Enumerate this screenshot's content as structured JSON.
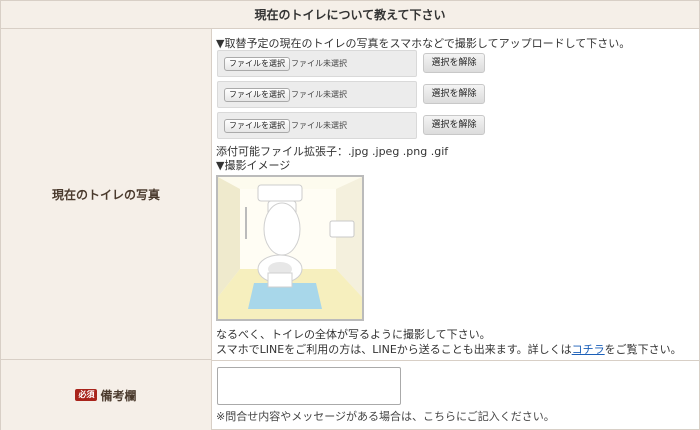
{
  "header": {
    "title": "現在のトイレについて教えて下さい"
  },
  "photo_row": {
    "label": "現在のトイレの写真",
    "instruction": "▼取替予定の現在のトイレの写真をスマホなどで撮影してアップロードして下さい。",
    "file_inputs": [
      {
        "button": "ファイルを選択",
        "status": "ファイル未選択",
        "clear_label": "選択を解除"
      },
      {
        "button": "ファイルを選択",
        "status": "ファイル未選択",
        "clear_label": "選択を解除"
      },
      {
        "button": "ファイルを選択",
        "status": "ファイル未選択",
        "clear_label": "選択を解除"
      }
    ],
    "allowed_ext": "添付可能ファイル拡張子：.jpg .jpeg .png .gif",
    "example_heading": "▼撮影イメージ",
    "note1": "なるべく、トイレの全体が写るように撮影して下さい。",
    "note2_prefix": "スマホでLINEをご利用の方は、LINEから送ることも出来ます。詳しくは",
    "note2_link": "コチラ",
    "note2_suffix": "をご覧下さい。"
  },
  "remarks_row": {
    "badge": "必須",
    "label": "備考欄",
    "textarea_value": "",
    "hint": "※問合せ内容やメッセージがある場合は、こちらにご記入ください。"
  },
  "colors": {
    "label_bg": "#f5efe8",
    "border": "#d8cfc6",
    "badge": "#a8241b",
    "link": "#1b5fb8"
  }
}
